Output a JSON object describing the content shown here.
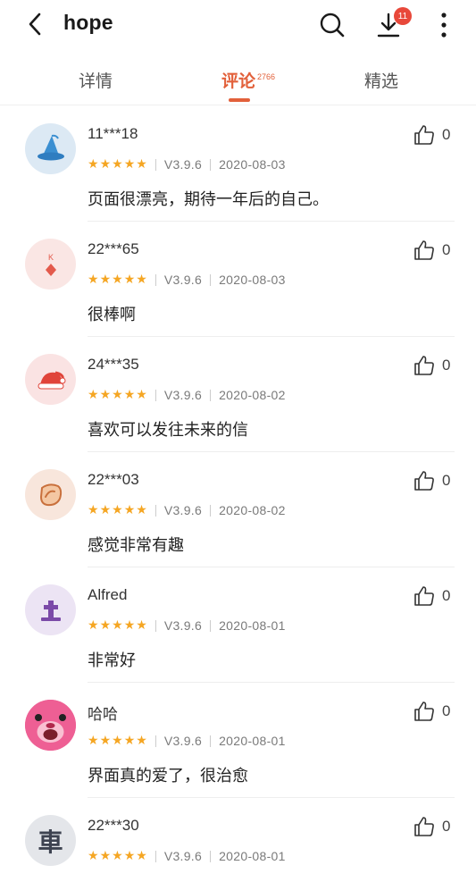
{
  "header": {
    "title": "hope",
    "download_badge": "11",
    "icons": [
      "back-icon",
      "search-icon",
      "download-icon",
      "more-icon"
    ]
  },
  "tabs": [
    {
      "label": "详情"
    },
    {
      "label": "评论",
      "count": "2766",
      "active": true
    },
    {
      "label": "精选"
    }
  ],
  "colors": {
    "accent": "#e2603a",
    "star": "#f5a623",
    "badge": "#e8483a"
  },
  "reviews": [
    {
      "user": "11***18",
      "stars": 5,
      "version": "V3.9.6",
      "date": "2020-08-03",
      "text": "页面很漂亮，期待一年后的自己。",
      "likes": "0",
      "avatar": "wizard-hat-icon"
    },
    {
      "user": "22***65",
      "stars": 5,
      "version": "V3.9.6",
      "date": "2020-08-03",
      "text": "很棒啊",
      "likes": "0",
      "avatar": "playing-card-icon"
    },
    {
      "user": "24***35",
      "stars": 5,
      "version": "V3.9.6",
      "date": "2020-08-02",
      "text": "喜欢可以发往未来的信",
      "likes": "0",
      "avatar": "santa-hat-icon"
    },
    {
      "user": "22***03",
      "stars": 5,
      "version": "V3.9.6",
      "date": "2020-08-02",
      "text": "感觉非常有趣",
      "likes": "0",
      "avatar": "steak-icon"
    },
    {
      "user": "Alfred",
      "stars": 5,
      "version": "V3.9.6",
      "date": "2020-08-01",
      "text": "非常好",
      "likes": "0",
      "avatar": "tombstone-icon"
    },
    {
      "user": "哈哈",
      "stars": 5,
      "version": "V3.9.6",
      "date": "2020-08-01",
      "text": "界面真的爱了，很治愈",
      "likes": "0",
      "avatar": "pink-bear-icon"
    },
    {
      "user": "22***30",
      "stars": 5,
      "version": "V3.9.6",
      "date": "2020-08-01",
      "text": "",
      "likes": "0",
      "avatar": "che-character-icon",
      "avatar_char": "車"
    }
  ]
}
